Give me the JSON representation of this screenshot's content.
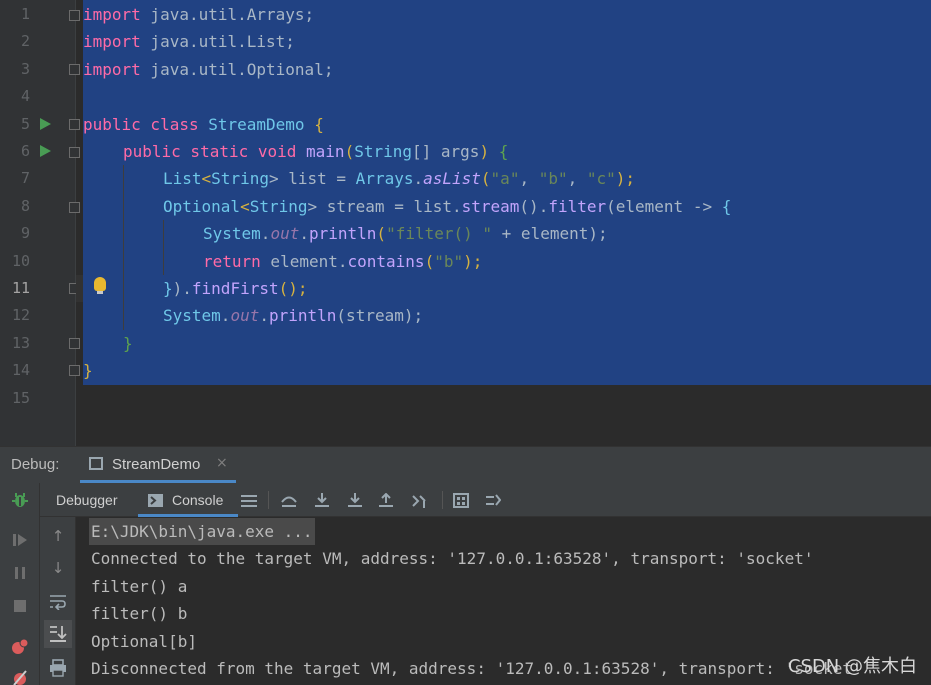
{
  "editor": {
    "line_numbers": [
      "1",
      "2",
      "3",
      "4",
      "5",
      "6",
      "7",
      "8",
      "9",
      "10",
      "11",
      "12",
      "13",
      "14",
      "15"
    ],
    "current_line": "11"
  },
  "code": {
    "l1": {
      "kw": "import",
      "rest": " java.util.Arrays;"
    },
    "l2": {
      "kw": "import",
      "rest": " java.util.List;"
    },
    "l3": {
      "kw": "import",
      "rest": " java.util.Optional;"
    },
    "l5": {
      "kw": "public class",
      "name": " StreamDemo",
      "brace": " {"
    },
    "l6": {
      "kw": "public static void",
      "fn": " main",
      "p1": "(",
      "cls": "String",
      "p2": "[] args",
      "p3": ")",
      "brace": " {"
    },
    "l7": {
      "cls1": "List",
      "p1": "<",
      "cls2": "String",
      "p2": "> list = ",
      "cls3": "Arrays",
      "p3": ".",
      "fn": "asList",
      "p4": "(",
      "s1": "\"a\"",
      "c1": ", ",
      "s2": "\"b\"",
      "c2": ", ",
      "s3": "\"c\"",
      "p5": ");"
    },
    "l8": {
      "cls1": "Optional",
      "p1": "<",
      "cls2": "String",
      "p2": "> stream = list.",
      "fn1": "stream",
      "p3": "().",
      "fn2": "filter",
      "p4": "(element -> ",
      "brace": "{"
    },
    "l9": {
      "cls": "System",
      "p1": ".",
      "fld": "out",
      "p2": ".",
      "fn": "println",
      "p3": "(",
      "s": "\"filter() \"",
      "p4": " + element);"
    },
    "l10": {
      "kw": "return",
      "p1": " element.",
      "fn": "contains",
      "p2": "(",
      "s": "\"b\"",
      "p3": ");"
    },
    "l11": {
      "brace": "}",
      "p1": ").",
      "fn": "findFirst",
      "p2": "();"
    },
    "l12": {
      "cls": "System",
      "p1": ".",
      "fld": "out",
      "p2": ".",
      "fn": "println",
      "p3": "(stream);"
    },
    "l13": {
      "brace": "}"
    },
    "l14": {
      "brace": "}"
    }
  },
  "debug": {
    "label": "Debug:",
    "tab_label": "StreamDemo",
    "tab_close": "×",
    "subtabs": {
      "debugger": "Debugger",
      "console": "Console"
    }
  },
  "console": {
    "lines": [
      "E:\\JDK\\bin\\java.exe ...",
      "Connected to the target VM, address: '127.0.0.1:63528', transport: 'socket'",
      "filter() a",
      "filter() b",
      "Optional[b]",
      "Disconnected from the target VM, address: '127.0.0.1:63528', transport: 'socket'"
    ]
  },
  "watermark": "CSDN @焦木白",
  "colors": {
    "selection": "#214283",
    "keyword": "#ff6ba7",
    "class": "#6fc7e8",
    "method": "#c2a4fc",
    "string": "#6a8759",
    "run": "#499c54",
    "accent": "#4a88c7"
  },
  "icons": [
    "fold-marker-icon",
    "run-icon",
    "lightbulb-icon",
    "debug-bug-icon",
    "resume-icon",
    "pause-icon",
    "stop-icon",
    "breakpoints-icon",
    "mute-breakpoints-icon",
    "console-icon",
    "menu-icon",
    "step-over-icon",
    "step-into-icon",
    "force-step-into-icon",
    "step-out-icon",
    "run-to-cursor-icon",
    "evaluate-icon",
    "trace-icon",
    "up-arrow-icon",
    "down-arrow-icon",
    "soft-wrap-icon",
    "scroll-to-end-icon",
    "print-icon"
  ]
}
